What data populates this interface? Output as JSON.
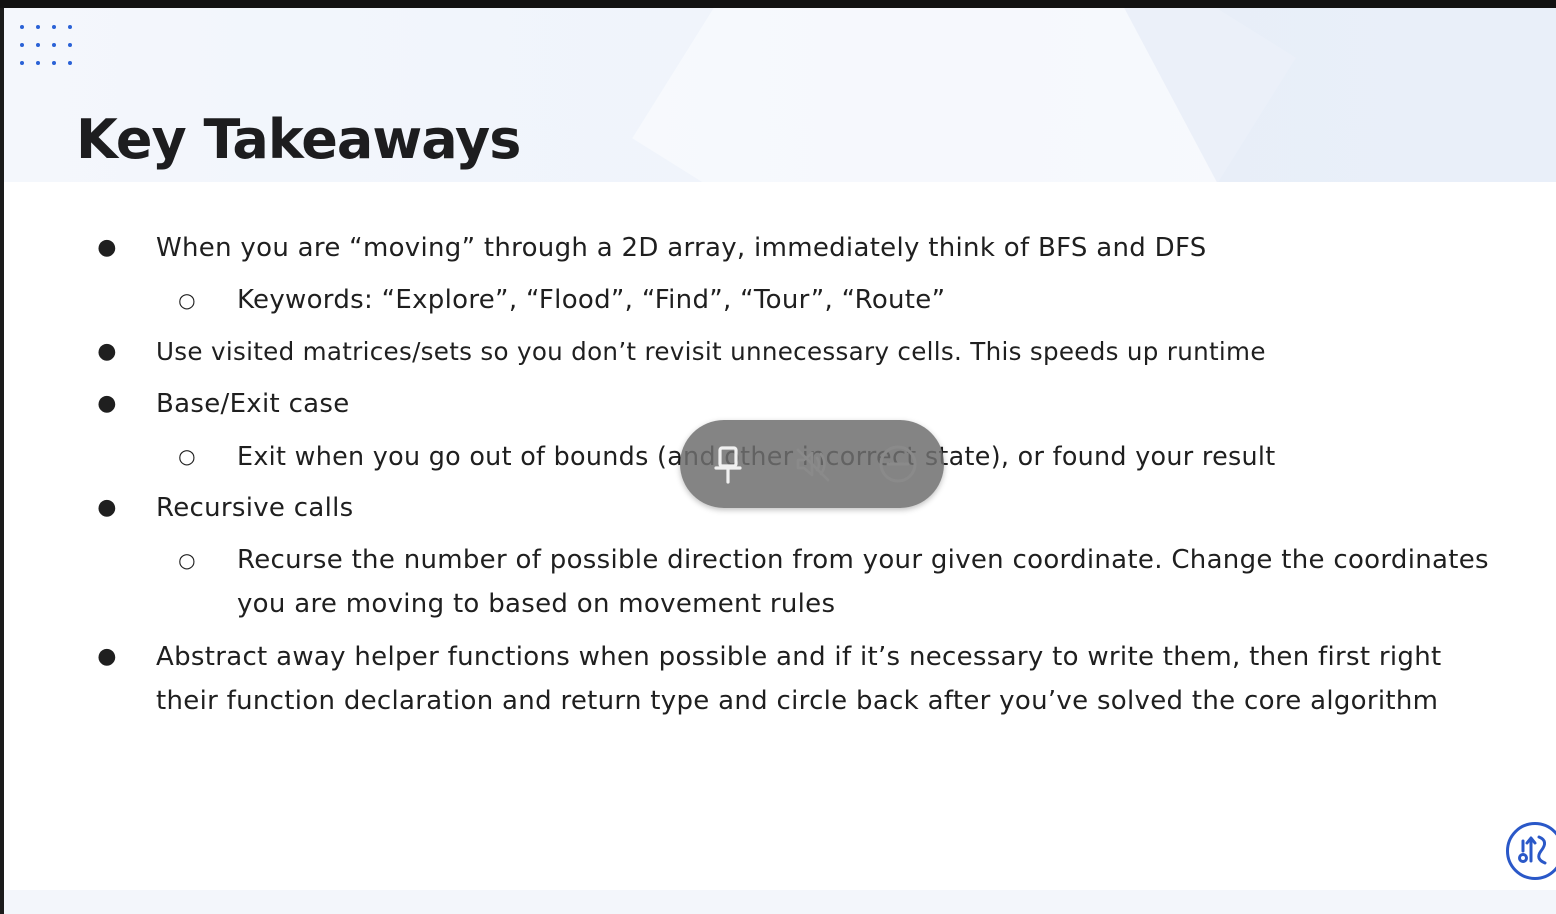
{
  "slide": {
    "title": "Key Takeaways",
    "bullets": [
      {
        "level": 1,
        "marker": "●",
        "text": "When you are “moving” through a 2D array, immediately think of BFS and DFS"
      },
      {
        "level": 2,
        "marker": "○",
        "text": "Keywords: “Explore”, “Flood”, “Find”, “Tour”, “Route”"
      },
      {
        "level": 1,
        "marker": "●",
        "text": "Use visited matrices/sets so you don’t revisit unnecessary cells. This speeds up runtime"
      },
      {
        "level": 1,
        "marker": "●",
        "text": "Base/Exit case"
      },
      {
        "level": 2,
        "marker": "○",
        "text": "Exit when you go out of bounds (and other incorrect state), or found your result"
      },
      {
        "level": 1,
        "marker": "●",
        "text": "Recursive calls"
      },
      {
        "level": 2,
        "marker": "○",
        "text": "Recurse the number of possible direction from your given coordinate. Change the coordinates you are moving to based on movement rules"
      },
      {
        "level": 1,
        "marker": "●",
        "text": "Abstract away helper functions when possible and if it’s necessary to write them, then first right their function declaration and return type and circle back after you’ve solved the core algorithm"
      }
    ]
  },
  "toolbar": {
    "buttons": [
      {
        "icon": "pin-icon"
      },
      {
        "icon": "mute-icon"
      },
      {
        "icon": "stop-icon"
      }
    ]
  },
  "icons": {
    "app_logo": "dots-grid-icon",
    "corner_badge": "assistant-icon"
  },
  "colors": {
    "accent": "#2a62d6",
    "title": "#1d1d1f",
    "body_text": "#1f1f1f",
    "toolbar_bg": "#6e6e6e"
  }
}
